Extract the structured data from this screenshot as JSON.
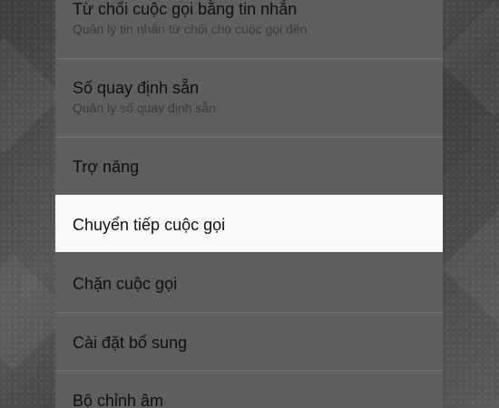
{
  "settings_list": {
    "items": [
      {
        "title": "Từ chối cuộc gọi bằng tin nhắn",
        "subtitle": "Quản lý tin nhắn từ chối cho cuộc gọi đến"
      },
      {
        "title": "Số quay định sẵn",
        "subtitle": "Quản lý số quay định sẵn"
      },
      {
        "title": "Trợ năng"
      },
      {
        "title": "Chuyển tiếp cuộc gọi",
        "highlighted": true
      },
      {
        "title": "Chặn cuộc gọi"
      },
      {
        "title": "Cài đặt bổ sung"
      },
      {
        "title": "Bộ chỉnh âm"
      }
    ]
  },
  "colors": {
    "overlay": "#5e5e5e",
    "highlight": "#fafafa",
    "background": "#4a4a4a"
  }
}
